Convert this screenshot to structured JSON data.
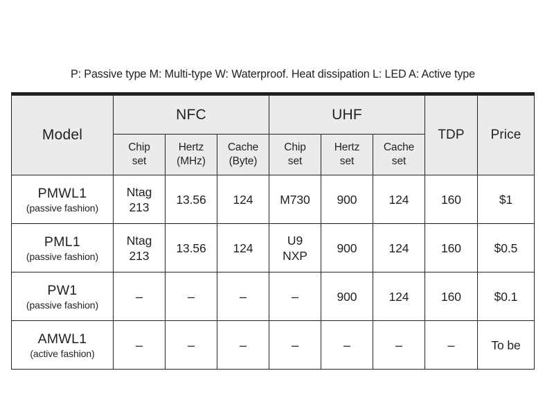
{
  "document": {
    "caption": "P: Passive type M: Multi-type W: Waterproof. Heat dissipation L: LED A: Active type"
  },
  "colors": {
    "header_background": "#ebebeb",
    "border": "#231f20",
    "text": "#231f20",
    "page_background": "#ffffff"
  },
  "table": {
    "group_headers": {
      "model": "Model",
      "nfc": "NFC",
      "uhf": "UHF",
      "tdp": "TDP",
      "price": "Price"
    },
    "sub_headers": {
      "nfc_chip_line1": "Chip",
      "nfc_chip_line2": "set",
      "nfc_hertz_line1": "Hertz",
      "nfc_hertz_line2": "(MHz)",
      "nfc_cache_line1": "Cache",
      "nfc_cache_line2": "(Byte)",
      "uhf_chip_line1": "Chip",
      "uhf_chip_line2": "set",
      "uhf_hertz_line1": "Hertz",
      "uhf_hertz_line2": "set",
      "uhf_cache_line1": "Cache",
      "uhf_cache_line2": "set"
    },
    "rows": [
      {
        "model_name": "PMWL1",
        "model_note": "(passive fashion)",
        "nfc_chip_line1": "Ntag",
        "nfc_chip_line2": "213",
        "nfc_hertz": "13.56",
        "nfc_cache": "124",
        "uhf_chip_line1": "M730",
        "uhf_chip_line2": "",
        "uhf_hertz": "900",
        "uhf_cache": "124",
        "tdp": "160",
        "price": "$1"
      },
      {
        "model_name": "PML1",
        "model_note": "(passive fashion)",
        "nfc_chip_line1": "Ntag",
        "nfc_chip_line2": "213",
        "nfc_hertz": "13.56",
        "nfc_cache": "124",
        "uhf_chip_line1": "U9",
        "uhf_chip_line2": "NXP",
        "uhf_hertz": "900",
        "uhf_cache": "124",
        "tdp": "160",
        "price": "$0.5"
      },
      {
        "model_name": "PW1",
        "model_note": "(passive fashion)",
        "nfc_chip_line1": "–",
        "nfc_chip_line2": "",
        "nfc_hertz": "–",
        "nfc_cache": "–",
        "uhf_chip_line1": "–",
        "uhf_chip_line2": "",
        "uhf_hertz": "900",
        "uhf_cache": "124",
        "tdp": "160",
        "price": "$0.1"
      },
      {
        "model_name": "AMWL1",
        "model_note": "(active fashion)",
        "nfc_chip_line1": "–",
        "nfc_chip_line2": "",
        "nfc_hertz": "–",
        "nfc_cache": "–",
        "uhf_chip_line1": "–",
        "uhf_chip_line2": "",
        "uhf_hertz": "–",
        "uhf_cache": "–",
        "tdp": "–",
        "price": "To be"
      }
    ]
  }
}
